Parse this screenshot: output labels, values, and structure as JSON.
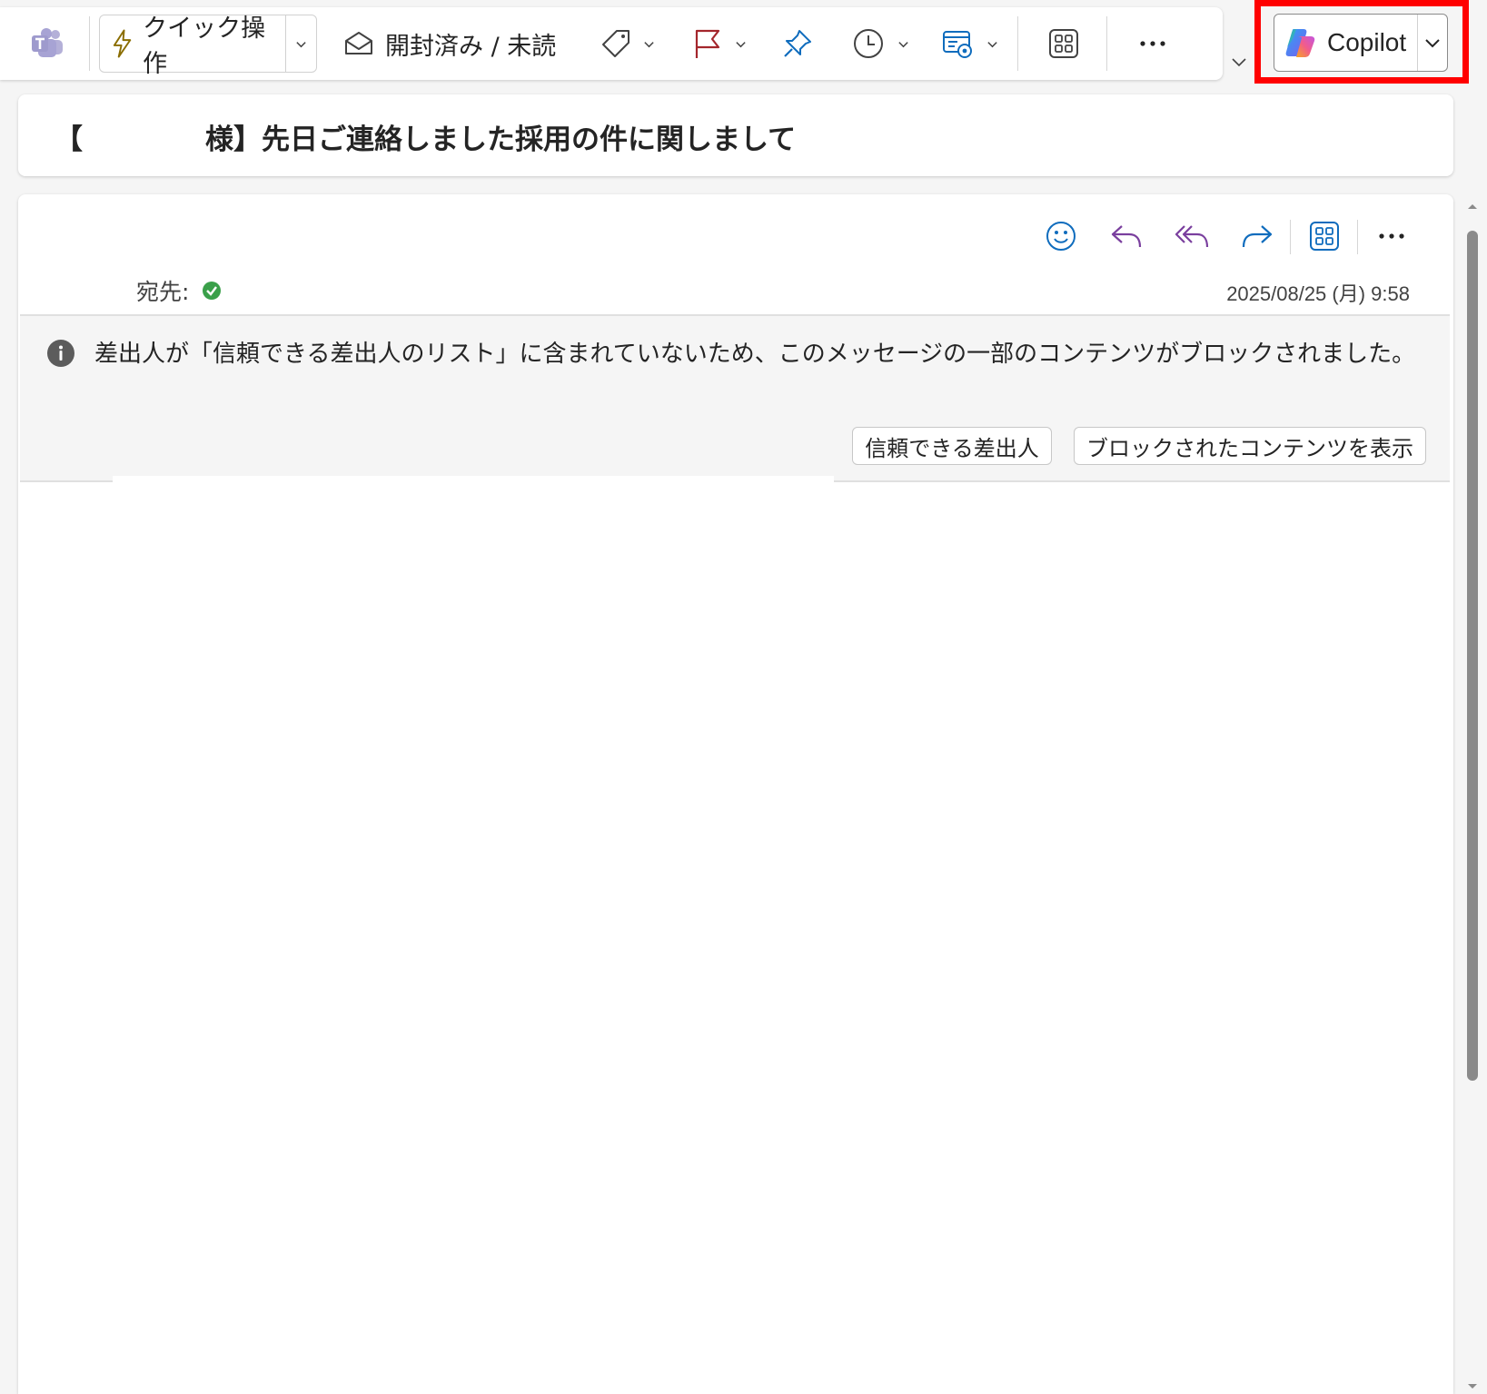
{
  "ribbon": {
    "quick_actions_label": "クイック操作",
    "read_unread_label": "開封済み / 未読",
    "more_label": "···"
  },
  "copilot": {
    "label": "Copilot"
  },
  "subject": {
    "prefix": "【",
    "text": "様】先日ご連絡しました採用の件に関しまして"
  },
  "message": {
    "to_label": "宛先:",
    "date": "2025/08/25 (月) 9:58",
    "more_label": "···"
  },
  "info_bar": {
    "text": "差出人が「信頼できる差出人のリスト」に含まれていないため、このメッセージの一部のコンテンツがブロックされました。",
    "trust_sender_button": "信頼できる差出人",
    "show_blocked_button": "ブロックされたコンテンツを表示"
  },
  "colors": {
    "accent_blue": "#0f6cbd",
    "reply_purple": "#7a3f9e",
    "flag_red": "#a4262c",
    "lightning_gold": "#8a6d00",
    "highlight_red": "#ff0000",
    "verified_green": "#3aa04a"
  },
  "icons": [
    "teams-icon",
    "lightning-icon",
    "envelope-open-icon",
    "tag-icon",
    "flag-icon",
    "pin-icon",
    "clock-icon",
    "rules-icon",
    "apps-icon",
    "more-icon",
    "copilot-icon",
    "emoji-icon",
    "reply-icon",
    "reply-all-icon",
    "forward-icon",
    "info-icon",
    "verified-icon"
  ]
}
